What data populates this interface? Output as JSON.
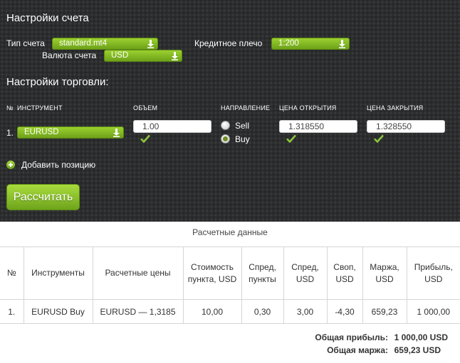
{
  "account_settings": {
    "title": "Настройки счета",
    "account_type_label": "Тип счета",
    "account_type_value": "standard.mt4",
    "leverage_label": "Кредитное плечо",
    "leverage_value": "1:200",
    "currency_label": "Валюта счета",
    "currency_value": "USD"
  },
  "trade_settings": {
    "title": "Настройки торговли:",
    "col_num": "№",
    "col_instrument": "ИНСТРУМЕНТ",
    "col_volume": "ОБЪЕМ",
    "col_direction": "НАПРАВЛЕНИЕ",
    "col_open_price": "ЦЕНА ОТКРЫТИЯ",
    "col_close_price": "ЦЕНА ЗАКРЫТИЯ",
    "row": {
      "num": "1.",
      "instrument": "EURUSD",
      "volume": "1.00",
      "direction_sell": "Sell",
      "direction_buy": "Buy",
      "selected_direction": "Buy",
      "open_price": "1.318550",
      "close_price": "1.328550"
    },
    "add_position": "Добавить позицию",
    "calculate_button": "Рассчитать"
  },
  "results": {
    "title": "Расчетные данные",
    "headers": [
      "№",
      "Инструменты",
      "Расчетные цены",
      "Стоимость пункта, USD",
      "Спред, пункты",
      "Спред, USD",
      "Своп, USD",
      "Маржа, USD",
      "Прибыль, USD"
    ],
    "rows": [
      [
        "1.",
        "EURUSD Buy",
        "EURUSD — 1,3185",
        "10,00",
        "0,30",
        "3,00",
        "-4,30",
        "659,23",
        "1 000,00"
      ]
    ],
    "total_profit_label": "Общая прибыль:",
    "total_profit_value": "1 000,00 USD",
    "total_margin_label": "Общая маржа:",
    "total_margin_value": "659,23 USD"
  },
  "colors": {
    "accent_green": "#8cc63e",
    "panel_dark": "#2c2d2e"
  }
}
